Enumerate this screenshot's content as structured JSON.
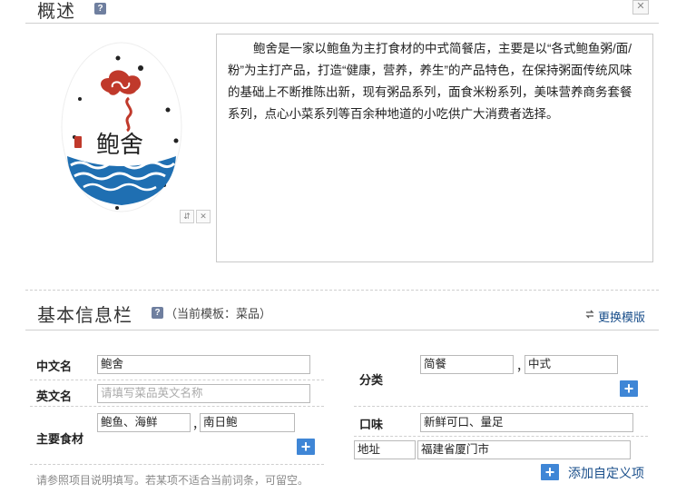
{
  "overview": {
    "title": "概述",
    "help_glyph": "?",
    "close_glyph": "✕",
    "summary_text": "鲍舍是一家以鲍鱼为主打食材的中式简餐店，主要是以“各式鲍鱼粥/面/粉”为主打产品，打造“健康，营养，养生”的产品特色，在保持粥面传统风味的基础上不断推陈出新，现有粥品系列，面食米粉系列，美味营养商务套餐系列，点心小菜系列等百余种地道的小吃供广大消费者选择。",
    "logo_text": "鲍舍",
    "image_controls": {
      "swap_glyph": "⇵",
      "remove_glyph": "✕"
    }
  },
  "basic_info": {
    "title": "基本信息栏",
    "help_glyph": "?",
    "template_note": "（当前模板：菜品）",
    "change_template_label": "更换模版",
    "fields": {
      "chinese_name": {
        "label": "中文名",
        "value": "鲍舍"
      },
      "english_name": {
        "label": "英文名",
        "placeholder": "请填写菜品英文名称"
      },
      "main_ingredients": {
        "label": "主要食材",
        "value1": "鲍鱼、海鲜",
        "separator": "，",
        "value2": "南日鲍"
      },
      "category": {
        "label": "分类",
        "value1": "简餐",
        "separator": "，",
        "value2": "中式"
      },
      "taste": {
        "label": "口味",
        "value": "新鲜可口、量足"
      },
      "address": {
        "label": "地址",
        "value": "福建省厦门市"
      }
    },
    "plus_glyph": "+",
    "hint": "请参照项目说明填写。若某项不适合当前词条，可留空。",
    "add_custom_label": "添加自定义项"
  },
  "colors": {
    "accent_blue": "#3f86d6",
    "link_blue": "#1a4f8b",
    "logo_red": "#c0392b",
    "logo_wave": "#1f6fb2"
  }
}
